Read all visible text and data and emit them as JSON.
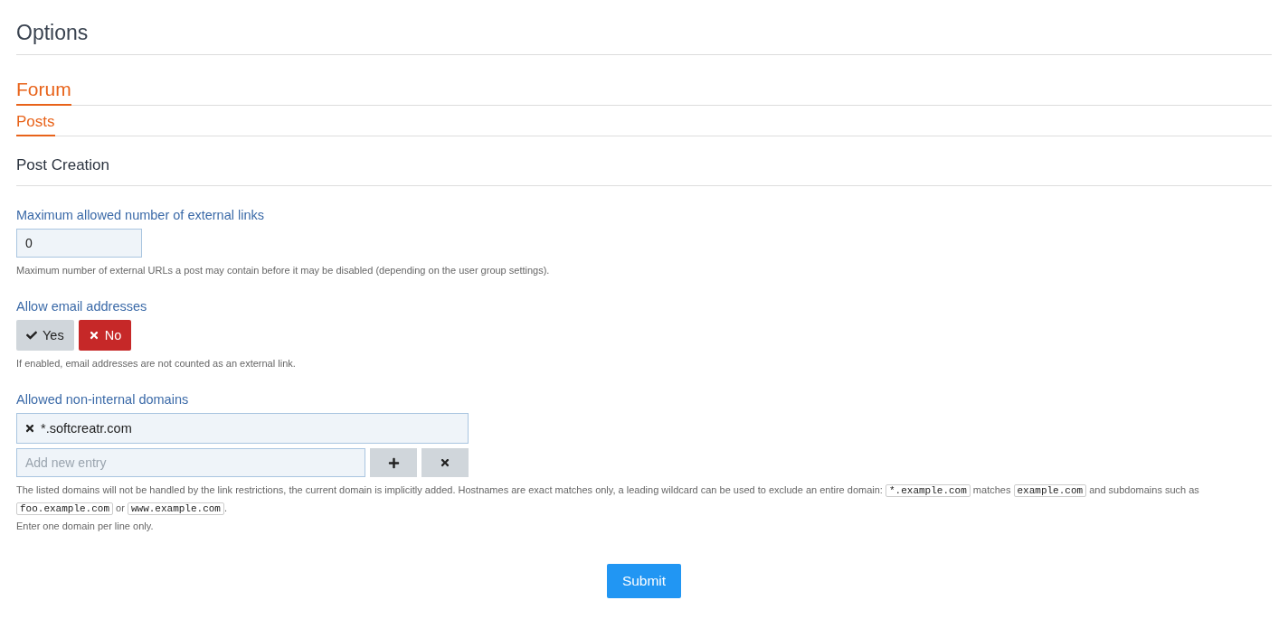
{
  "page_title": "Options",
  "breadcrumbs": [
    {
      "label": "Forum"
    },
    {
      "label": "Posts"
    }
  ],
  "section_title": "Post Creation",
  "fields": [
    {
      "kind": "number",
      "label": "Maximum allowed number of external links",
      "value": "0",
      "description": [
        {
          "kind": "text",
          "text": "Maximum number of external URLs a post may contain before it may be disabled (depending on the user group settings)."
        }
      ]
    },
    {
      "kind": "toggle",
      "label": "Allow email addresses",
      "options": [
        {
          "label": "Yes",
          "selected": false
        },
        {
          "label": "No",
          "selected": true
        }
      ],
      "description": [
        {
          "kind": "text",
          "text": "If enabled, email addresses are not counted as an external link."
        }
      ]
    },
    {
      "kind": "list",
      "label": "Allowed non-internal domains",
      "entries": [
        "*.softcreatr.com"
      ],
      "placeholder": "Add new entry",
      "description": [
        {
          "kind": "text",
          "text": "The listed domains will not be handled by the link restrictions, the current domain is implicitly added. Hostnames are exact matches only, a leading wildcard can be used to exclude an entire domain: "
        },
        {
          "kind": "code",
          "text": "*.example.com"
        },
        {
          "kind": "text",
          "text": " matches "
        },
        {
          "kind": "code",
          "text": "example.com"
        },
        {
          "kind": "text",
          "text": " and subdomains such as "
        },
        {
          "kind": "code",
          "text": "foo.example.com"
        },
        {
          "kind": "text",
          "text": " or "
        },
        {
          "kind": "code",
          "text": "www.example.com"
        },
        {
          "kind": "text",
          "text": "."
        },
        {
          "kind": "break"
        },
        {
          "kind": "text",
          "text": "Enter one domain per line only."
        }
      ]
    }
  ],
  "submit": "Submit"
}
